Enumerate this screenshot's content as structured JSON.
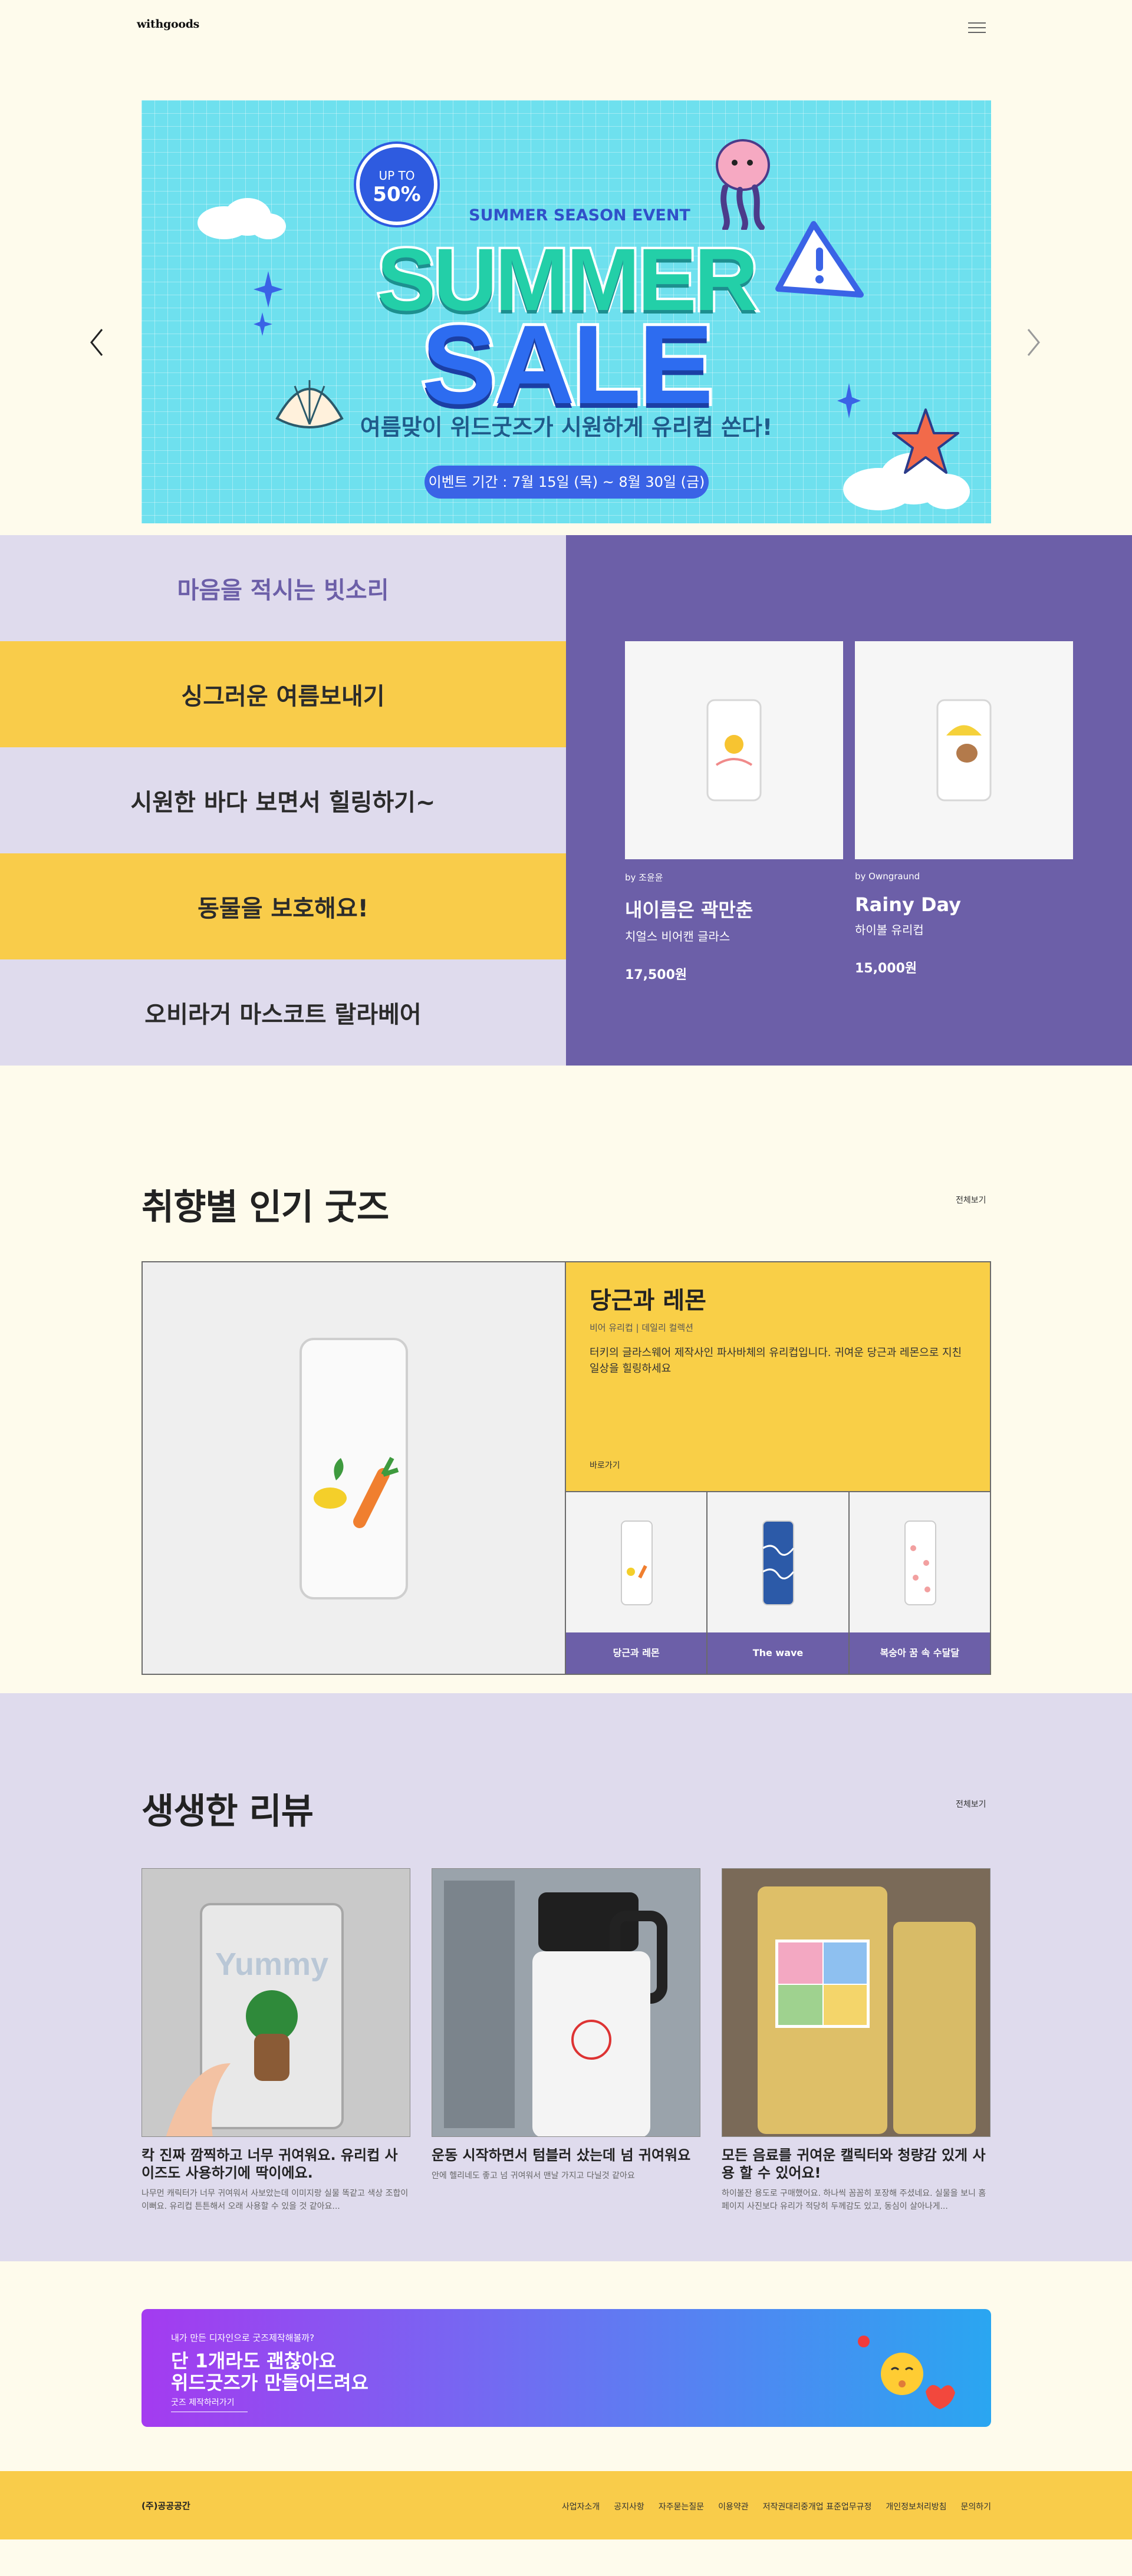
{
  "header": {
    "logo": "withgoods",
    "menu_icon": "hamburger-icon"
  },
  "hero": {
    "badge_small": "UP TO",
    "badge_big": "50%",
    "eyebrow": "SUMMER SEASON EVENT",
    "title_line1": "SUMMER",
    "title_line2": "SALE",
    "subtitle": "여름맞이 위드굿즈가 시원하게 유리컵 쏜다!",
    "date": "이벤트 기간 : 7월 15일 (목) ~ 8월 30일 (금)",
    "slide_count": 4,
    "active_slide": 4
  },
  "themes": {
    "items": [
      "마음을 적시는 빗소리",
      "싱그러운 여름보내기",
      "시원한 바다 보면서 힐링하기~",
      "동물을 보호해요!",
      "오비라거 마스코트 랄라베어"
    ],
    "products": [
      {
        "by": "by 조윤윤",
        "name": "내이름은 곽만춘",
        "category": "치얼스 비어캔 글라스",
        "price": "17,500원"
      },
      {
        "by": "by Owngraund",
        "name": "Rainy Day",
        "category": "하이볼 유리컵",
        "price": "15,000원"
      }
    ]
  },
  "popular": {
    "title": "취향별 인기 굿즈",
    "more": "전체보기",
    "featured": {
      "name": "당근과 레몬",
      "meta": "비어 유리컵 | 데일리 컬렉션",
      "desc": "터키의 글라스웨어 제작사인 파사바체의 유리컵입니다. 귀여운 당근과 레몬으로 지친 일상을 힐링하세요",
      "link": "바로가기"
    },
    "thumbs": [
      "당근과 레몬",
      "The wave",
      "복숭아 꿈 속 수달달"
    ]
  },
  "reviews": {
    "title": "생생한 리뷰",
    "more": "전체보기",
    "items": [
      {
        "title": "칵 진짜 깜찍하고 너무 귀여워요. 유리컵 사이즈도 사용하기에 딱이에요.",
        "desc": "나무먼 캐릭터가 너무 귀여워서 사보았는데 이미지랑 실물 똑같고 색상 조합이 이뻐요. 유리컵 튼튼해서 오래 사용할 수 있을 것 같아요..."
      },
      {
        "title": "운동 시작하면서 텀블러 샀는데 넘 귀여워요",
        "desc": "안에 헬리네도 좋고 넘 귀여워서 맨날 가지고 다닐것 같아요"
      },
      {
        "title": "모든 음료를 귀여운 캘릭터와 청량감 있게 사용 할 수 있어요!",
        "desc": "하이볼잔 용도로 구매했어요. 하나씩 꼼꼼히 포장해 주셨네요. 실물을 보니 홈페이지 사진보다 유리가 적당히 두께감도 있고, 동심이 살아나게..."
      }
    ]
  },
  "cta": {
    "question": "내가 만든 디자인으로 굿즈제작해볼까?",
    "headline_1": "단 1개라도 괜찮아요",
    "headline_2": "위드굿즈가 만들어드려요",
    "link": "굿즈 제작하러가기"
  },
  "footer": {
    "company": "(주)공공공간",
    "links": [
      "사업자소개",
      "공지사항",
      "자주묻는질문",
      "이용약관",
      "저작권대리중개업 표준업무규정",
      "개인정보처리방침",
      "문의하기"
    ]
  },
  "colors": {
    "purple": "#6c5fa8",
    "lavender": "#dfdbed",
    "yellow": "#f9cc4a",
    "cream": "#fefbec"
  }
}
